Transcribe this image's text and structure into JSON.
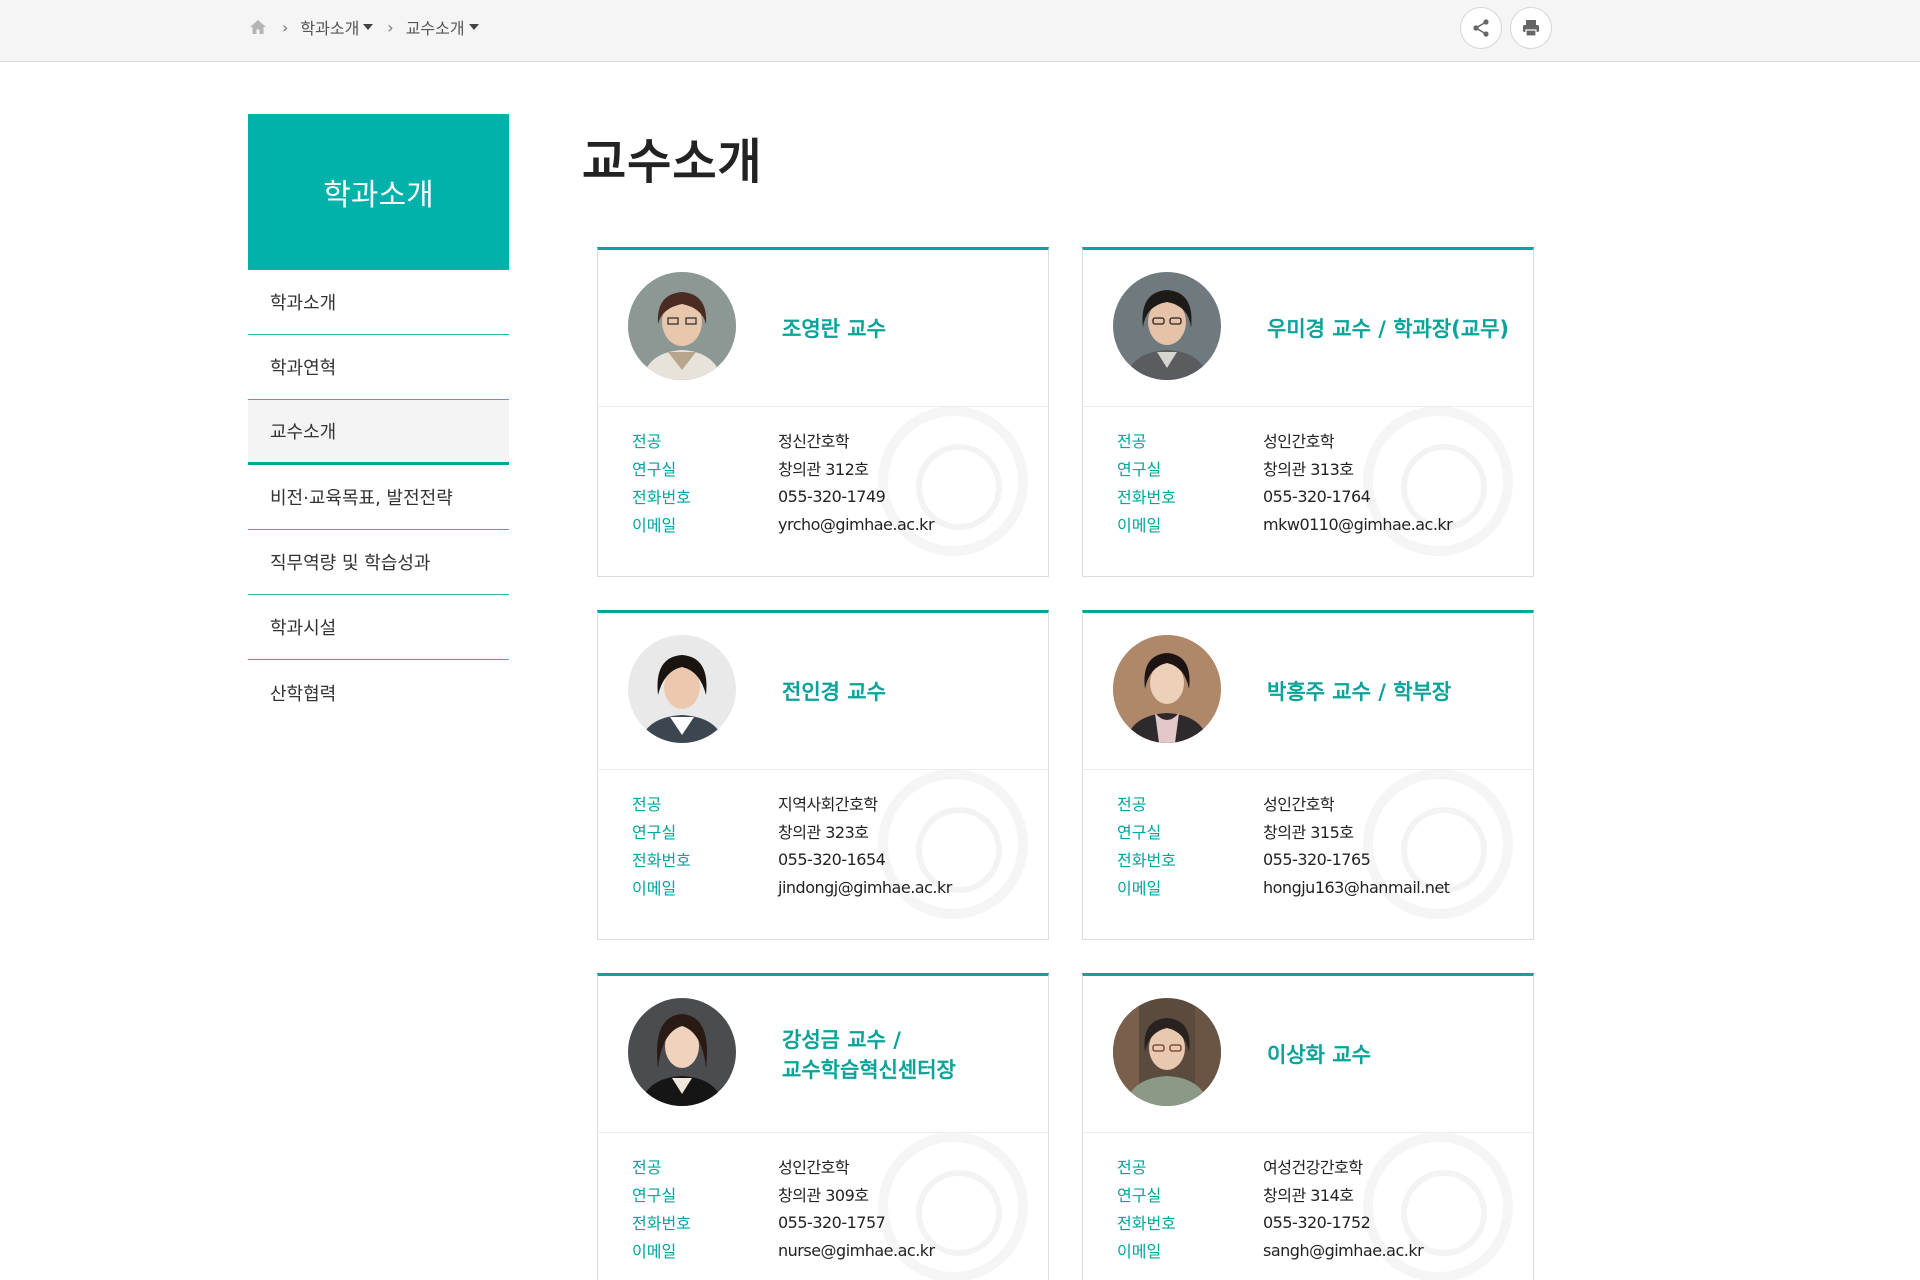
{
  "breadcrumb": {
    "items": [
      {
        "label": "학과소개"
      },
      {
        "label": "교수소개"
      }
    ]
  },
  "sidebar": {
    "title": "학과소개",
    "items": [
      {
        "label": "학과소개"
      },
      {
        "label": "학과연혁"
      },
      {
        "label": "교수소개"
      },
      {
        "label": "비전·교육목표, 발전전략"
      },
      {
        "label": "직무역량 및 학습성과"
      },
      {
        "label": "학과시설"
      },
      {
        "label": "산학협력"
      }
    ],
    "active_index": 2
  },
  "page": {
    "title": "교수소개"
  },
  "field_labels": {
    "major": "전공",
    "office": "연구실",
    "phone": "전화번호",
    "email": "이메일"
  },
  "professors": [
    {
      "name": "조영란 교수",
      "major": "정신간호학",
      "office": "창의관 312호",
      "phone": "055-320-1749",
      "email": "yrcho@gimhae.ac.kr"
    },
    {
      "name": "우미경 교수 / 학과장(교무)",
      "major": "성인간호학",
      "office": "창의관 313호",
      "phone": "055-320-1764",
      "email": "mkw0110@gimhae.ac.kr"
    },
    {
      "name": "전인경 교수",
      "major": "지역사회간호학",
      "office": "창의관 323호",
      "phone": "055-320-1654",
      "email": "jindongj@gimhae.ac.kr"
    },
    {
      "name": "박홍주 교수 / 학부장",
      "major": "성인간호학",
      "office": "창의관 315호",
      "phone": "055-320-1765",
      "email": "hongju163@hanmail.net"
    },
    {
      "name_line1": "강성금 교수 /",
      "name_line2": "교수학습혁신센터장",
      "major": "성인간호학",
      "office": "창의관 309호",
      "phone": "055-320-1757",
      "email": "nurse@gimhae.ac.kr"
    },
    {
      "name": "이상화 교수",
      "major": "여성건강간호학",
      "office": "창의관 314호",
      "phone": "055-320-1752",
      "email": "sangh@gimhae.ac.kr"
    }
  ],
  "colors": {
    "accent": "#00b2a9",
    "accent_text": "#0aa39a"
  },
  "icons": {
    "home": "home-icon",
    "share": "share-icon",
    "print": "print-icon"
  }
}
